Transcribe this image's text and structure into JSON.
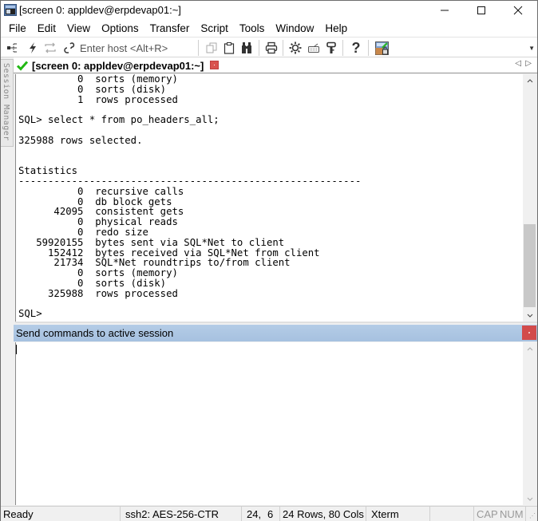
{
  "window": {
    "title": "[screen 0: appldev@erpdevap01:~]",
    "controls": {
      "minimize": "—",
      "maximize": "☐",
      "close": "✕"
    }
  },
  "menu": {
    "items": [
      "File",
      "Edit",
      "View",
      "Options",
      "Transfer",
      "Script",
      "Tools",
      "Window",
      "Help"
    ]
  },
  "toolbar": {
    "host_placeholder": "Enter host <Alt+R>",
    "icons": [
      "connect-in-tab-icon",
      "quick-connect-icon",
      "reconnect-icon",
      "disconnect-icon",
      "copy-icon",
      "paste-icon",
      "find-icon",
      "print-icon",
      "session-options-icon",
      "keymap-icon",
      "key-icon",
      "help-icon",
      "sftp-icon"
    ]
  },
  "sidebar": {
    "session_manager_label": "Session Manager"
  },
  "tabs": {
    "active": {
      "label": "[screen 0: appldev@erpdevap01:~]",
      "status": "connected"
    },
    "nav_prev": "◁",
    "nav_next": "▷"
  },
  "terminal": {
    "lines": [
      "          0  sorts (memory)",
      "          0  sorts (disk)",
      "          1  rows processed",
      "",
      "SQL> select * from po_headers_all;",
      "",
      "325988 rows selected.",
      "",
      "",
      "Statistics",
      "----------------------------------------------------------",
      "          0  recursive calls",
      "          0  db block gets",
      "      42095  consistent gets",
      "          0  physical reads",
      "          0  redo size",
      "   59920155  bytes sent via SQL*Net to client",
      "     152412  bytes received via SQL*Net from client",
      "      21734  SQL*Net roundtrips to/from client",
      "          0  sorts (memory)",
      "          0  sorts (disk)",
      "     325988  rows processed",
      "",
      "SQL> "
    ],
    "scroll_position": 0.85
  },
  "command_window": {
    "title": "Send commands to active session",
    "value": ""
  },
  "status_bar": {
    "state": "Ready",
    "cipher": "ssh2: AES-256-CTR",
    "cursor_row": "24,",
    "cursor_col": "6",
    "dimensions": "24 Rows, 80 Cols",
    "terminal_type": "Xterm",
    "caps": "CAP",
    "num": "NUM"
  },
  "colors": {
    "accent_header": "#a6c1e0",
    "close_red": "#d24b4b",
    "check_green": "#22b814"
  }
}
